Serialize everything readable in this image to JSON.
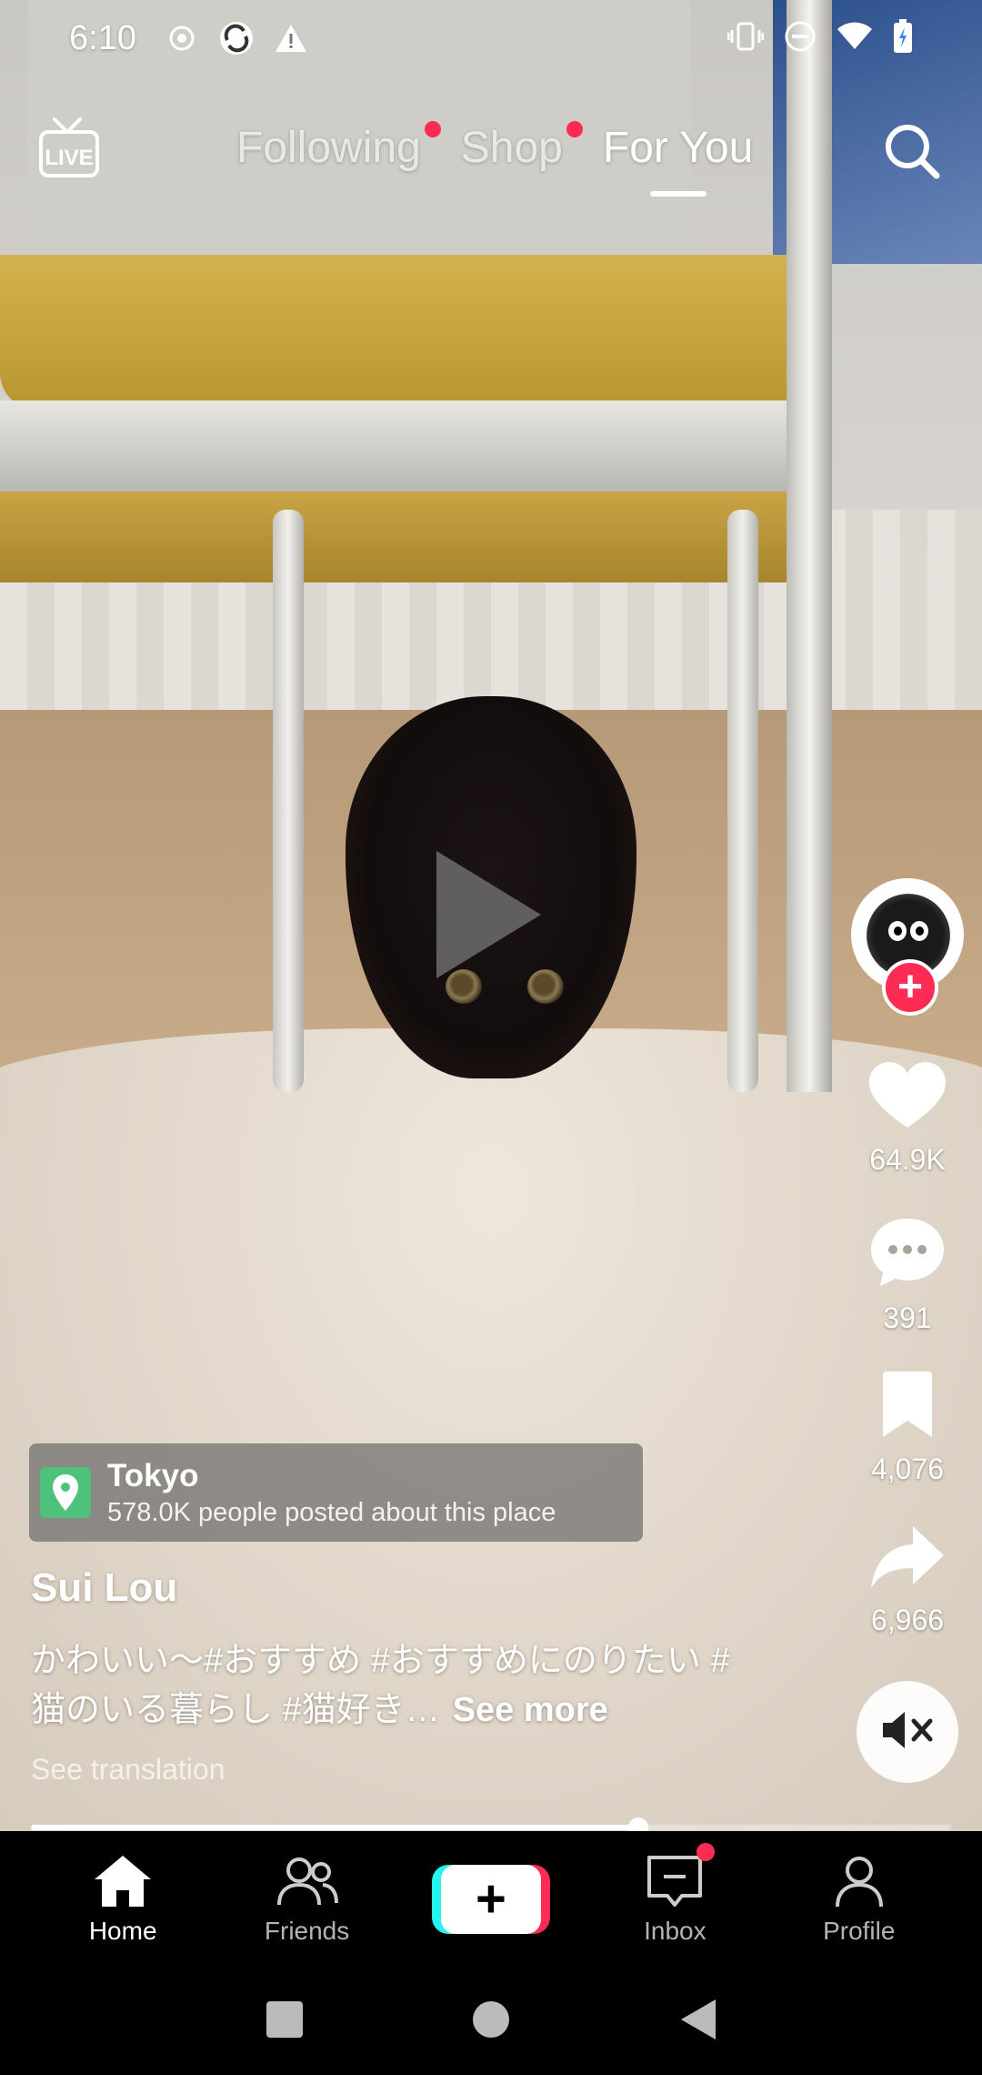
{
  "status_bar": {
    "time": "6:10"
  },
  "top_nav": {
    "live_label": "LIVE",
    "tabs": [
      {
        "label": "Following",
        "has_dot": true,
        "active": false
      },
      {
        "label": "Shop",
        "has_dot": true,
        "active": false
      },
      {
        "label": "For You",
        "has_dot": false,
        "active": true
      }
    ]
  },
  "video": {
    "location": {
      "name": "Tokyo",
      "subtitle": "578.0K people posted about this place"
    },
    "author": "Sui  Lou",
    "caption": "かわいい〜#おすすめ #おすすめにのりたい #猫のいる暮らし #猫好き…",
    "see_more": "See more",
    "see_translation": "See translation",
    "progress_fraction": 0.66
  },
  "actions": {
    "likes": "64.9K",
    "comments": "391",
    "saves": "4,076",
    "shares": "6,966"
  },
  "bottom_nav": {
    "home": "Home",
    "friends": "Friends",
    "inbox": "Inbox",
    "profile": "Profile"
  },
  "colors": {
    "accent": "#fe2c55",
    "cyan": "#25f4ee",
    "location_pin": "#4ec17b"
  }
}
